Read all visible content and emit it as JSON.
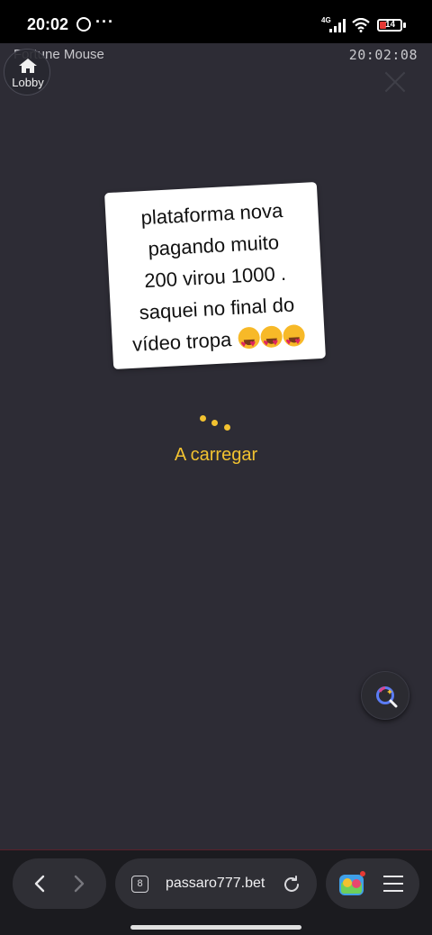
{
  "status_bar": {
    "time": "20:02",
    "more": "···",
    "network": "4G",
    "battery": "14",
    "battery_color": "#e53935"
  },
  "game": {
    "title": "Fortune Mouse",
    "clock": "20:02:08",
    "lobby_label": "Lobby",
    "background": "#2d2c35",
    "sticker_lines": [
      "plataforma nova",
      "pagando muito",
      "200 virou 1000 .",
      "saquei no final do",
      "vídeo tropa"
    ],
    "emoji_icon": "heart-eyes-emoji",
    "loading_text": "A carregar",
    "accent_color": "#f2c230"
  },
  "browser": {
    "tab_count": "8",
    "url": "passaro777.bet"
  }
}
